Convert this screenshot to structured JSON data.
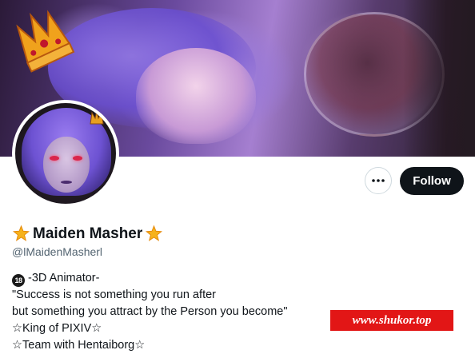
{
  "profile": {
    "display_name": "Maiden Masher",
    "handle": "@lMaidenMasherl",
    "name_emoji_left": "star-icon",
    "name_emoji_right": "star-icon"
  },
  "actions": {
    "more_icon": "more-horizontal-icon",
    "follow_label": "Follow"
  },
  "bio": {
    "badge": "18",
    "lines": [
      "-3D Animator-",
      "\"Success is not something you run after",
      "but something you attract by the Person you become\"",
      "☆King of PIXIV☆",
      "☆Team with Hentaiborg☆"
    ]
  },
  "watermark": {
    "text": "www.shukor.top"
  },
  "colors": {
    "follow_bg": "#0f1419",
    "handle_text": "#536471",
    "watermark_bg": "#e21616",
    "star": "#f6b21b"
  }
}
